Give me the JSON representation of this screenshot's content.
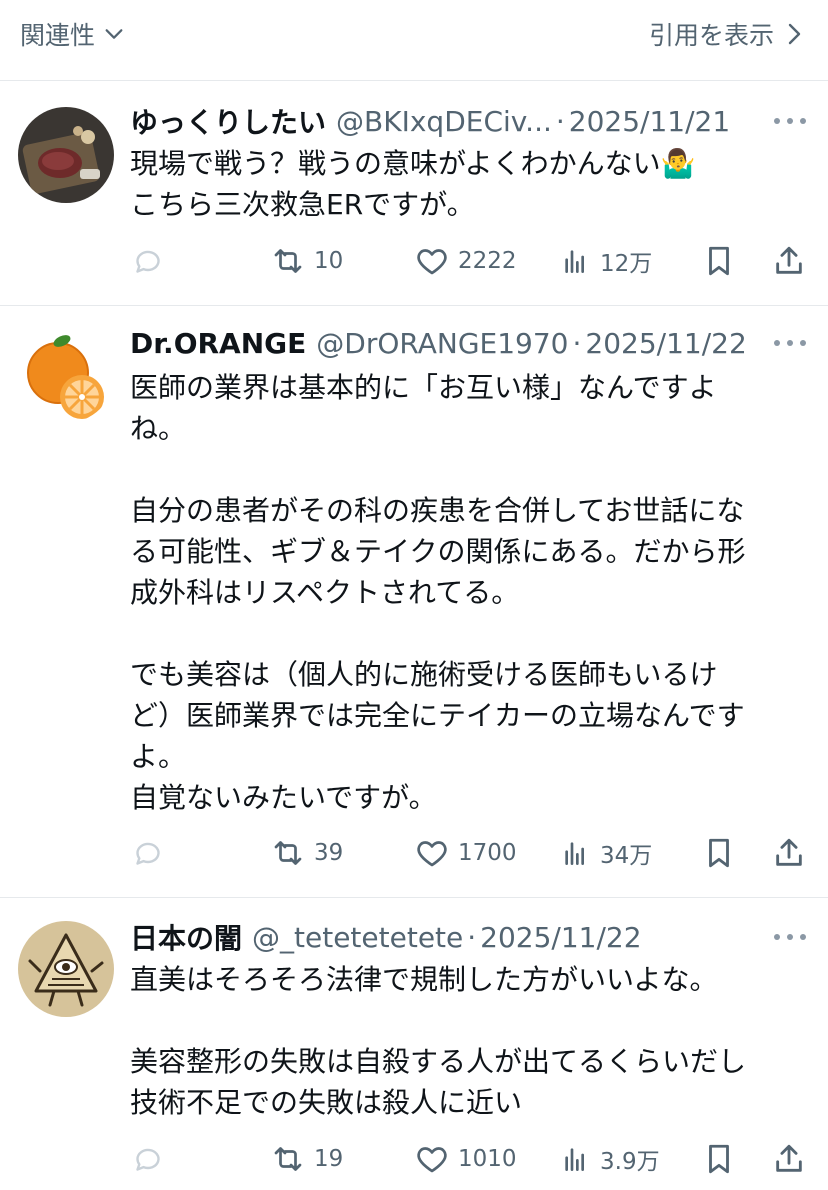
{
  "topbar": {
    "sort_label": "関連性",
    "quotes_label": "引用を表示"
  },
  "tweets": [
    {
      "name": "ゆっくりしたい",
      "handle": "@BKIxqDECiv...",
      "date": "2025/11/21",
      "lines": [
        "現場で戦う？戦うの意味がよくわかんない🤷‍♂️",
        "こちら三次救急ERですが。"
      ],
      "retweets": "10",
      "likes": "2222",
      "views": "12万"
    },
    {
      "name": "Dr.ORANGE",
      "handle": "@DrORANGE1970",
      "date": "2025/11/22",
      "lines": [
        "医師の業界は基本的に「お互い様」なんですよ",
        "ね。",
        "",
        "自分の患者がその科の疾患を合併してお世話にな",
        "る可能性、ギブ＆テイクの関係にある。だから形",
        "成外科はリスペクトされてる。",
        "",
        "でも美容は（個人的に施術受ける医師もいるけ",
        "ど）医師業界では完全にテイカーの立場なんです",
        "よ。",
        "自覚ないみたいですが。"
      ],
      "retweets": "39",
      "likes": "1700",
      "views": "34万"
    },
    {
      "name": "日本の闇",
      "handle": "@_tetetetetete",
      "date": "2025/11/22",
      "lines": [
        "直美はそろそろ法律で規制した方がいいよな。",
        "",
        "美容整形の失敗は自殺する人が出てるくらいだし",
        "技術不足での失敗は殺人に近い"
      ],
      "retweets": "19",
      "likes": "1010",
      "views": "3.9万"
    }
  ],
  "colors": {
    "text": "#0f1419",
    "muted": "#536471",
    "divider": "#e6e9ec"
  },
  "icons": [
    "chevron-down-icon",
    "chevron-right-icon",
    "reply-icon",
    "retweet-icon",
    "like-icon",
    "views-icon",
    "bookmark-icon",
    "share-icon",
    "more-icon"
  ]
}
